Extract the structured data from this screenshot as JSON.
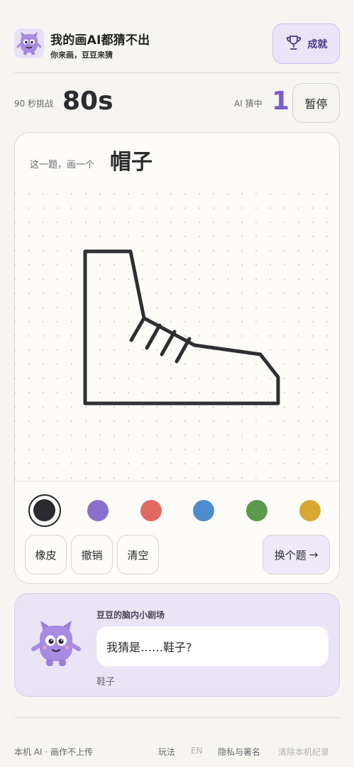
{
  "header": {
    "title": "我的画AI都猜不出",
    "subtitle": "你来画，豆豆来猜",
    "logo_icon": "purple-monster-mascot",
    "achievements_label": "成就",
    "achievements_icon": "trophy-icon"
  },
  "status": {
    "challenge_label": "90 秒挑战",
    "timer": "80s",
    "ai_label": "AI 猜中",
    "ai_count": "1",
    "pause_label": "暂停"
  },
  "canvas": {
    "prompt_label": "这一题，画一个",
    "prompt_word": "帽子",
    "palette": [
      {
        "name": "black",
        "color": "#2b2b2f",
        "selected": true
      },
      {
        "name": "purple",
        "color": "#8a6fcd",
        "selected": false
      },
      {
        "name": "red",
        "color": "#e06a62",
        "selected": false
      },
      {
        "name": "blue",
        "color": "#4d8ccd",
        "selected": false
      },
      {
        "name": "green",
        "color": "#5b9a4c",
        "selected": false
      },
      {
        "name": "yellow",
        "color": "#d9a832",
        "selected": false
      }
    ],
    "tools": {
      "eraser": "橡皮",
      "undo": "撤销",
      "clear": "清空",
      "next": "换个题",
      "next_arrow": "→"
    }
  },
  "theater": {
    "title": "豆豆的脑内小剧场",
    "bubble_text": "我猜是……鞋子?",
    "guess_word": "鞋子",
    "mascot_icon": "purple-monster-mascot"
  },
  "footer": {
    "left": "本机 AI · 画作不上传",
    "links": [
      "玩法",
      "EN",
      "隐私与署名",
      "清除本机纪录"
    ]
  },
  "colors": {
    "accent": "#7b5cc9",
    "background": "#f6f5f1",
    "card": "#fdfcf8",
    "theater_bg": "#ebe4f6"
  }
}
